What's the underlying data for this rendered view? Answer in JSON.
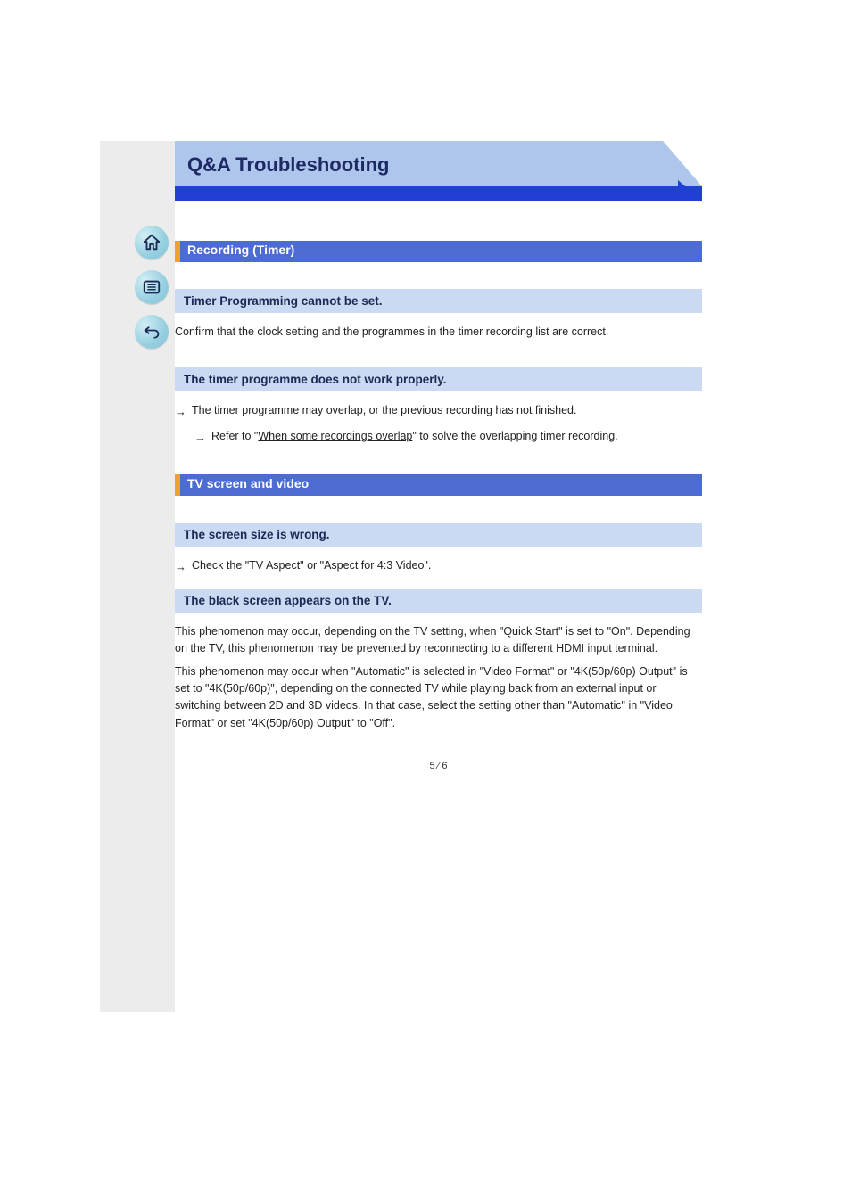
{
  "banner": {
    "title": "Q&A  Troubleshooting"
  },
  "section1": {
    "heading": "Recording (Timer)",
    "sub1": {
      "title": "Timer Programming cannot be set.",
      "body": "Confirm that the clock setting and the programmes in the timer recording list are correct."
    },
    "sub2": {
      "title": "The timer programme does not work properly.",
      "r1": "The timer programme may overlap, or the previous recording has not finished.",
      "r2_pre": "Refer to \"",
      "r2_link": "When some recordings overlap",
      "r2_post": "\" to solve the overlapping timer recording."
    }
  },
  "section2": {
    "heading": "TV screen and video",
    "sub1": {
      "title": "The screen size is wrong.",
      "r1": "Check the \"TV Aspect\" or \"Aspect for 4:3 Video\"."
    },
    "sub2": {
      "title": "The black screen appears on the TV.",
      "body1": "This phenomenon may occur, depending on the TV setting, when \"Quick Start\" is set to \"On\". Depending on the TV, this phenomenon may be prevented by reconnecting to a different HDMI input terminal.",
      "body2": "This phenomenon may occur when \"Automatic\" is selected in \"Video Format\" or \"4K(50p/60p) Output\" is set to \"4K(50p/60p)\", depending on the connected TV while playing back from an external input or switching between 2D and 3D videos. In that case, select the setting other than \"Automatic\" in \"Video Format\" or set \"4K(50p/60p) Output\" to \"Off\"."
    }
  },
  "page": {
    "num": "5",
    "total": "6"
  }
}
